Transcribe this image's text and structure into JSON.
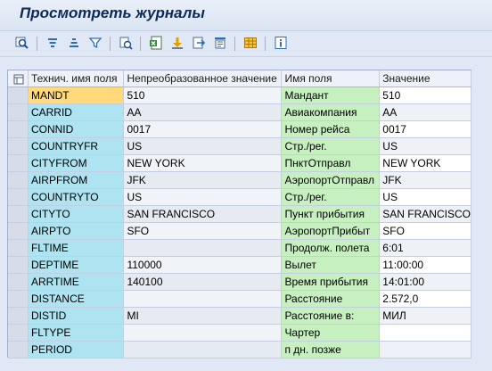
{
  "window": {
    "title": "Просмотреть журналы"
  },
  "toolbar": {
    "buttons": [
      {
        "icon": "find-icon"
      },
      {
        "icon": "sort-ascending-icon"
      },
      {
        "icon": "sort-descending-icon"
      },
      {
        "icon": "filter-icon"
      },
      {
        "icon": "details-icon"
      },
      {
        "icon": "export-excel-icon"
      },
      {
        "icon": "export-icon"
      },
      {
        "icon": "send-icon"
      },
      {
        "icon": "print-icon"
      },
      {
        "icon": "layout-icon"
      },
      {
        "icon": "info-icon"
      }
    ]
  },
  "grid": {
    "headers": [
      "Технич. имя поля",
      "Непреобразованное значение",
      "Имя поля",
      "Значение"
    ],
    "rows": [
      [
        "MANDT",
        "510",
        "Мандант",
        "510"
      ],
      [
        "CARRID",
        "AA",
        "Авиакомпания",
        "AA"
      ],
      [
        "CONNID",
        "0017",
        "Номер рейса",
        "0017"
      ],
      [
        "COUNTRYFR",
        "US",
        "Стр./рег.",
        "US"
      ],
      [
        "CITYFROM",
        "NEW YORK",
        "ПнктОтправл",
        "NEW YORK"
      ],
      [
        "AIRPFROM",
        "JFK",
        "АэропортОтправл",
        "JFK"
      ],
      [
        "COUNTRYTO",
        "US",
        "Стр./рег.",
        "US"
      ],
      [
        "CITYTO",
        "SAN FRANCISCO",
        "Пункт прибытия",
        "SAN FRANCISCO"
      ],
      [
        "AIRPTO",
        "SFO",
        "АэропортПрибыт",
        "SFO"
      ],
      [
        "FLTIME",
        "",
        "Продолж. полета",
        "6:01"
      ],
      [
        "DEPTIME",
        "110000",
        "Вылет",
        "11:00:00"
      ],
      [
        "ARRTIME",
        "140100",
        "Время прибытия",
        "14:01:00"
      ],
      [
        "DISTANCE",
        "",
        "Расстояние",
        "2.572,0"
      ],
      [
        "DISTID",
        "MI",
        "Расстояние в:",
        "МИЛ"
      ],
      [
        "FLTYPE",
        "",
        "Чартер",
        ""
      ],
      [
        "PERIOD",
        "",
        "п дн. позже",
        ""
      ]
    ]
  }
}
